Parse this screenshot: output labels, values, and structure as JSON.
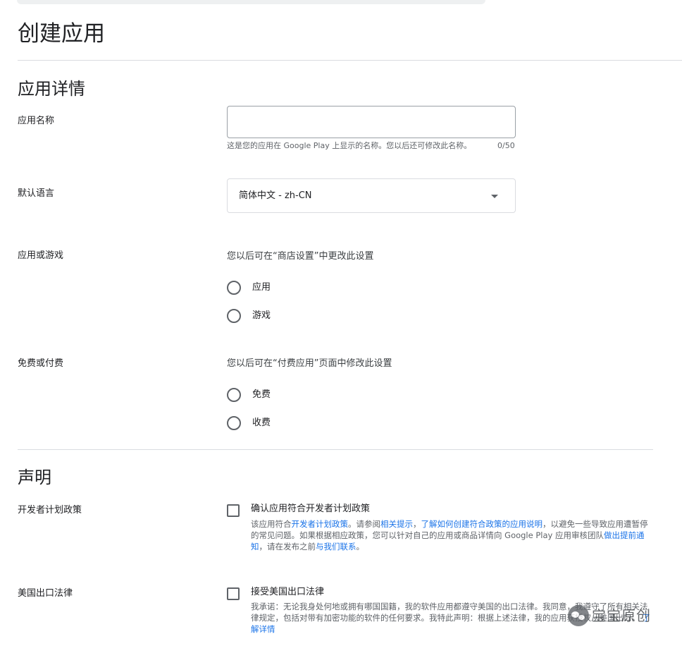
{
  "page": {
    "title": "创建应用"
  },
  "app_details": {
    "section_title": "应用详情",
    "app_name": {
      "label": "应用名称",
      "value": "",
      "placeholder": "",
      "helper": "这是您的应用在 Google Play 上显示的名称。您以后还可修改此名称。",
      "counter": "0/50"
    },
    "default_language": {
      "label": "默认语言",
      "selected": "简体中文 - zh-CN"
    },
    "app_or_game": {
      "label": "应用或游戏",
      "description": "您以后可在“商店设置”中更改此设置",
      "options": [
        "应用",
        "游戏"
      ]
    },
    "free_or_paid": {
      "label": "免费或付费",
      "description": "您以后可在“付费应用”页面中修改此设置",
      "options": [
        "免费",
        "收费"
      ]
    }
  },
  "declarations": {
    "section_title": "声明",
    "developer_policy": {
      "label": "开发者计划政策",
      "checkbox_title": "确认应用符合开发者计划政策",
      "desc_1": "该应用符合",
      "link_1": "开发者计划政策",
      "desc_2": "。请参阅",
      "link_2": "相关提示",
      "desc_3": "，",
      "link_3": "了解如何创建符合政策的应用说明",
      "desc_4": "，以避免一些导致应用遭暂停的常见问题。如果根据相应政策，您可以针对自己的应用或商品详情向 Google Play 应用审核团队",
      "link_4": "做出提前通知",
      "desc_5": "，请在发布之前",
      "link_5": "与我们联系",
      "desc_6": "。"
    },
    "us_export_law": {
      "label": "美国出口法律",
      "checkbox_title": "接受美国出口法律",
      "desc_1": "我承诺：无论我身处何地或拥有哪国国籍，我的软件应用都遵守美国的出口法律。我同意，我遵守了所有相关法律规定，包括对带有加密功能的软件的任何要求。我特此声明：根据上述法律，我的应用获授权从美国出口。",
      "link_1": "了解详情"
    }
  },
  "watermark": {
    "text": "宝宝原创"
  }
}
